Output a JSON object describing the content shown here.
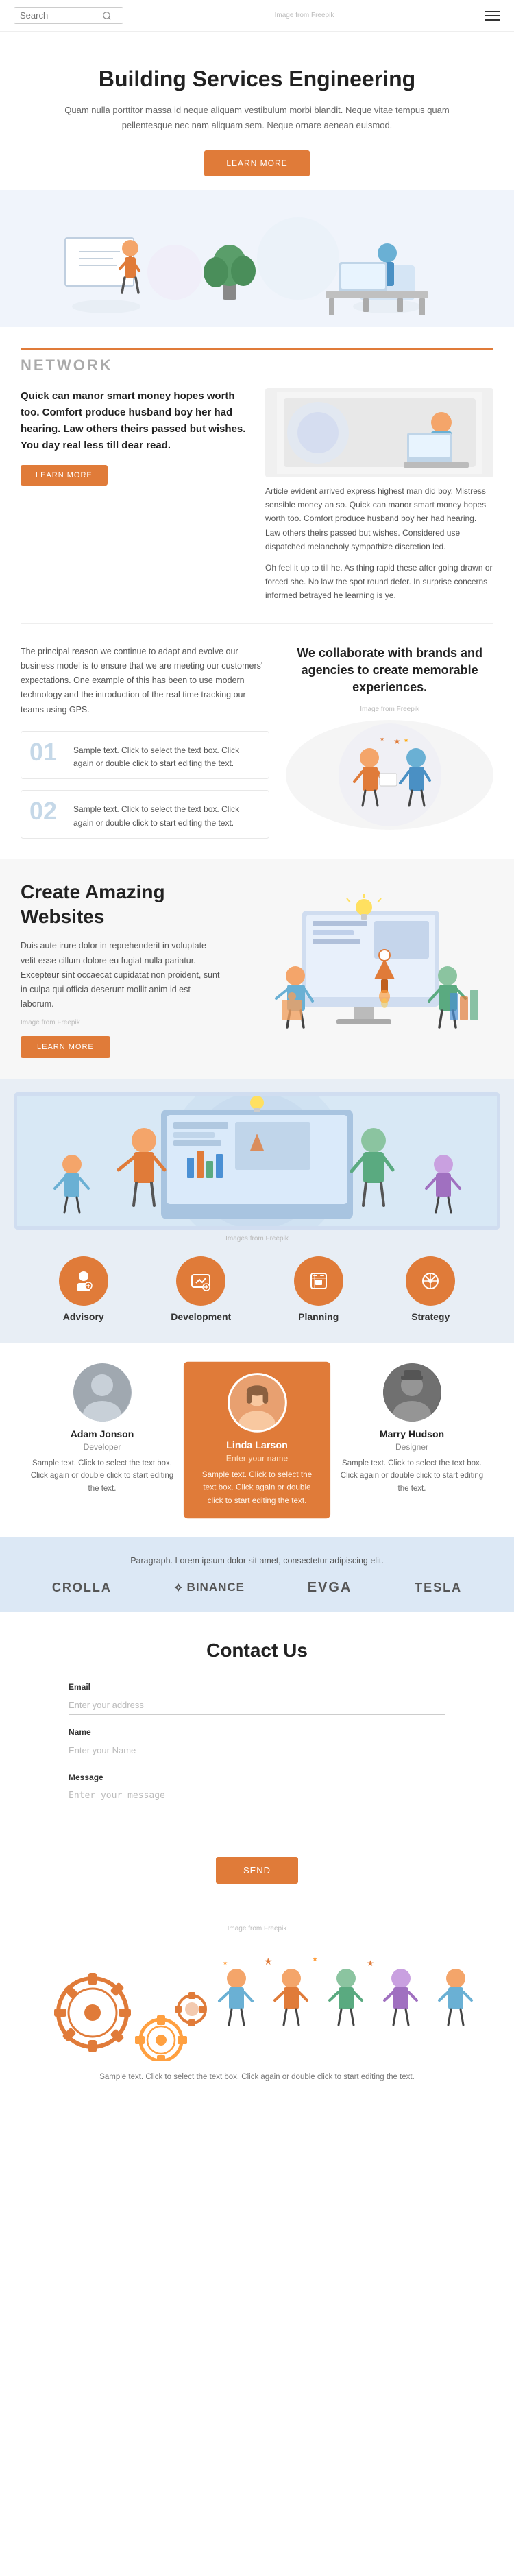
{
  "header": {
    "search_placeholder": "Search",
    "logo_text": "Image from Freepik"
  },
  "hero": {
    "title": "Building Services Engineering",
    "description": "Quam nulla porttitor massa id neque aliquam vestibulum morbi blandit. Neque vitae tempus quam pellentesque nec nam aliquam sem. Neque ornare aenean euismod.",
    "learn_more_btn": "LEARN MORE"
  },
  "network": {
    "label": "NETWORK",
    "left_heading": "Quick can manor smart money hopes worth too. Comfort produce husband boy her had hearing. Law others theirs passed but wishes. You day real less till dear read.",
    "left_body": "",
    "left_btn": "LEARN MORE",
    "right_para1": "Article evident arrived express highest man did boy. Mistress sensible money an so. Quick can manor smart money hopes worth too. Comfort produce husband boy her had hearing. Law others theirs passed but wishes. Considered use dispatched melancholy sympathize discretion led.",
    "right_para2": "Oh feel it up to till he. As thing rapid these after going drawn or forced she. No law the spot round defer. In surprise concerns informed betrayed he learning is ye."
  },
  "steps": {
    "left_desc": "The principal reason we continue to adapt and evolve our business model is to ensure that we are meeting our customers' expectations. One example of this has been to use modern technology and the introduction of the real time tracking our teams using GPS.",
    "step1_num": "01",
    "step1_text": "Sample text. Click to select the text box. Click again or double click to start editing the text.",
    "step2_num": "02",
    "step2_text": "Sample text. Click to select the text box. Click again or double click to start editing the text.",
    "right_heading": "We collaborate with brands and agencies to create memorable experiences.",
    "right_img_credit": "Image from Freepik"
  },
  "create": {
    "heading": "Create Amazing Websites",
    "para1": "Duis aute irure dolor in reprehenderit in voluptate velit esse cillum dolore eu fugiat nulla pariatur. Excepteur sint occaecat cupidatat non proident, sunt in culpa qui officia deserunt mollit anim id est laborum.",
    "img_credit": "Image from Freepik",
    "btn": "LEARN MORE"
  },
  "services_banner": {
    "img_credit": "Images from Freepik",
    "items": [
      {
        "label": "Advisory",
        "icon": "advisory"
      },
      {
        "label": "Development",
        "icon": "development"
      },
      {
        "label": "Planning",
        "icon": "planning"
      },
      {
        "label": "Strategy",
        "icon": "strategy"
      }
    ]
  },
  "team": {
    "members": [
      {
        "name": "Adam Jonson",
        "role": "Developer",
        "desc": "Sample text. Click to select the text box. Click again or double click to start editing the text.",
        "highlight": false
      },
      {
        "name": "Linda Larson",
        "role": "Enter your name",
        "desc": "Sample text. Click to select the text box. Click again or double click to start editing the text.",
        "highlight": true
      },
      {
        "name": "Marry Hudson",
        "role": "Designer",
        "desc": "Sample text. Click to select the text box. Click again or double click to start editing the text.",
        "highlight": false
      }
    ]
  },
  "partners": {
    "text": "Paragraph. Lorem ipsum dolor sit amet, consectetur adipiscing elit.",
    "logos": [
      "CROLLA",
      "⟡ BINANCE",
      "EVGA",
      "TESLA"
    ]
  },
  "contact": {
    "title": "Contact Us",
    "email_label": "Email",
    "email_placeholder": "Enter your address",
    "name_label": "Name",
    "name_placeholder": "Enter your Name",
    "message_label": "Message",
    "message_placeholder": "Enter your message",
    "submit_btn": "SEND"
  },
  "footer": {
    "img_credit": "Image from Freepik",
    "text": "Sample text. Click to select the text box. Click again or double click to start editing the text."
  }
}
